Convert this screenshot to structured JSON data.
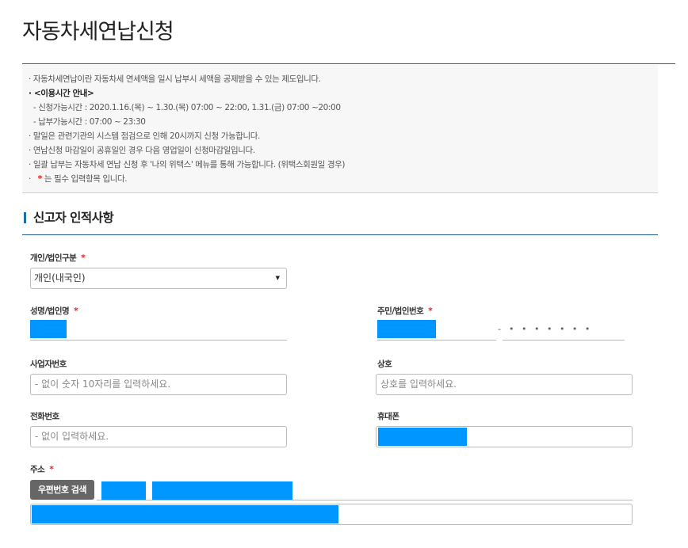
{
  "page": {
    "title": "자동차세연납신청"
  },
  "notice": {
    "lines": [
      "· 자동차세연납이란 자동차세 연세액을 일시 납부시 세액을 공제받을 수 있는 제도입니다.",
      "· <이용시간 안내>",
      "  - 신청가능시간 : 2020.1.16.(목) ~ 1.30.(목) 07:00 ~ 22:00, 1.31.(금) 07:00 ~20:00",
      "  - 납부가능시간 : 07:00 ~ 23:30",
      "· 말일은 관련기관의 시스템 점검으로 인해 20시까지 신청 가능합니다.",
      "· 연납신청 마감일이 공휴일인 경우 다음 영업일이 신청마감일입니다.",
      "· 일괄 납부는 자동차세 연납 신청 후 '나의 위택스' 메뉴를 통해 가능합니다. (위택스회원일 경우)"
    ],
    "required_prefix": "· ",
    "required_star": "*",
    "required_text": " 는 필수 입력항목 입니다."
  },
  "section": {
    "title": "신고자 인적사항"
  },
  "form": {
    "required_mark": "*",
    "type_label": "개인/법인구분",
    "type_value": "개인(내국인)",
    "type_arrow": "▼",
    "name_label": "성명/법인명",
    "id_label": "주민/법인번호",
    "id_sep": "-",
    "id_back_mask": "• • • • • • •",
    "bizno_label": "사업자번호",
    "bizno_placeholder": "- 없이 숫자 10자리를 입력하세요.",
    "company_label": "상호",
    "company_placeholder": "상호를 입력하세요.",
    "phone_label": "전화번호",
    "phone_placeholder": "- 없이 입력하세요.",
    "mobile_label": "휴대폰",
    "address_label": "주소",
    "zip_button": "우편번호 검색"
  },
  "colors": {
    "mask": "#0096ff",
    "accent": "#1f5c86",
    "required": "#e0241b",
    "button": "#666666"
  }
}
